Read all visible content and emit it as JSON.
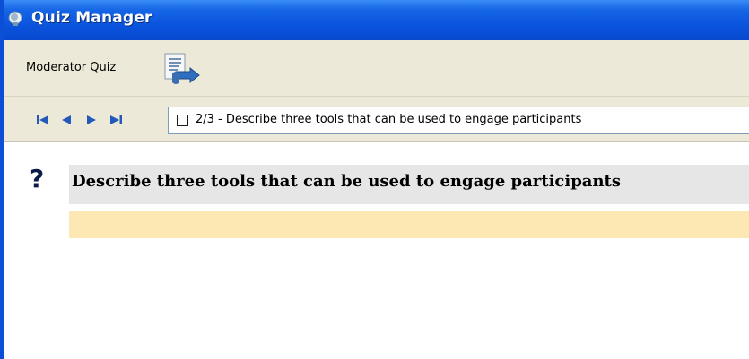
{
  "window": {
    "title": "Quiz Manager",
    "app_icon": "lightbulb-icon"
  },
  "header": {
    "quiz_name": "Moderator Quiz",
    "quiz_icon": "send-quiz-icon"
  },
  "navigation": {
    "buttons": [
      {
        "name": "first-question-button",
        "icon": "skip-to-first-icon"
      },
      {
        "name": "previous-question-button",
        "icon": "previous-icon"
      },
      {
        "name": "next-question-button",
        "icon": "next-icon"
      },
      {
        "name": "last-question-button",
        "icon": "skip-to-last-icon"
      }
    ],
    "current_question_label": "2/3 - Describe three tools that can be used to engage participants",
    "checked": false
  },
  "question": {
    "icon": "question-mark-icon",
    "mark": "?",
    "text": "Describe three tools that can be used to engage participants",
    "answer": ""
  },
  "colors": {
    "titlebar": "#0b55df",
    "toolbar": "#ece9d8",
    "question_bg": "#e6e6e6",
    "answer_bg": "#fde8b4"
  }
}
